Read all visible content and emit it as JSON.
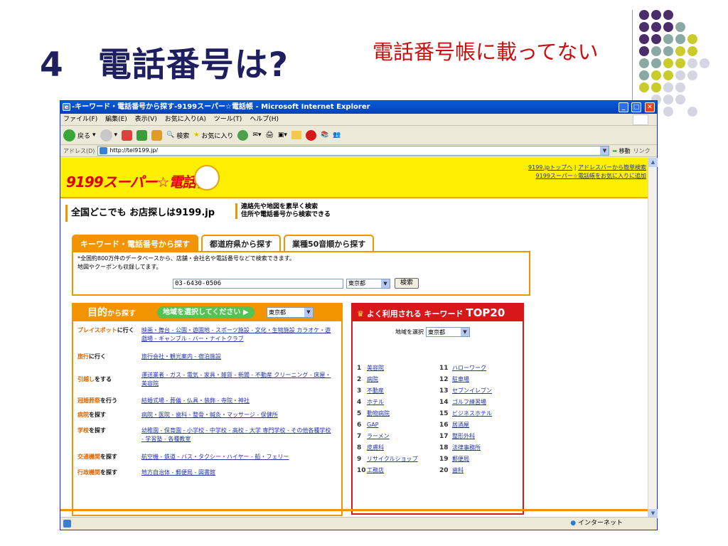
{
  "slide": {
    "title": "4　電話番号は?",
    "subtitle": "電話番号帳に載ってない"
  },
  "window": {
    "title": "-キーワード・電話番号から探す-9199スーパー☆電話帳 - Microsoft Internet Explorer",
    "menu": [
      "ファイル(F)",
      "編集(E)",
      "表示(V)",
      "お気に入り(A)",
      "ツール(T)",
      "ヘルプ(H)"
    ],
    "toolbar": {
      "back": "戻る",
      "search": "検索",
      "favorites": "お気に入り"
    },
    "address_label": "アドレス(D)",
    "address_value": "http://tel9199.jp/",
    "go_label": "移動",
    "links_label": "リンク",
    "status_zone": "インターネット"
  },
  "page": {
    "logo": "9199スーパー☆電話帳",
    "header_links": [
      "9199.jpトップへ",
      "アドレスバーから簡単検索",
      "9199スーパー☆電話帳をお気に入りに追加"
    ],
    "tagline": "全国どこでも お店探しは9199.jp",
    "tagline2": [
      "連絡先や地図を素早く検索",
      "住所や電話番号から検索できる"
    ],
    "tabs": [
      "キーワード・電話番号から探す",
      "都道府県から探す",
      "業種50音順から探す"
    ],
    "search": {
      "desc1": "*全国約800万件のデータベースから、店舗・会社名や電話番号などで検索できます。",
      "desc2": "地図やクーポンも収録してます。",
      "keyword_value": "03-6430-0506",
      "prefecture": "東京都",
      "button": "検索"
    },
    "purpose": {
      "title": "目的",
      "title_suffix": "から探す",
      "region_prompt": "地域を選択してください ▶",
      "region_value": "東京都",
      "rows": [
        {
          "label_em": "プレイスポット",
          "label": "に行く",
          "links": "映画・舞台 - 公園・遊園地 - スポーツ施設 - 文化・生物施設 カラオケ・遊戯場 - ギャンブル - バー・ナイトクラブ"
        },
        {
          "label_em": "旅行",
          "label": "に行く",
          "links": "旅行会社・観光案内 - 宿泊施設"
        },
        {
          "label_em": "引越し",
          "label": "をする",
          "links": "運送業者 - ガス - 電気 - 家具・雑貨 - 新聞 - 不動産 クリーニング - 床屋・美容院"
        },
        {
          "label_em": "冠婚葬祭",
          "label": "を行う",
          "links": "結婚式場 - 葬儀 - 仏具・装飾 - 寺院・神社"
        },
        {
          "label_em": "病院",
          "label": "を探す",
          "links": "病院・医院 - 歯科 - 整骨・鍼灸・マッサージ - 保健所"
        },
        {
          "label_em": "学校",
          "label": "を探す",
          "links": "幼稚園 - 保育園 - 小学校 - 中学校 - 高校 - 大学 専門学校 - その他各種学校 - 学習塾 - 各種教室"
        },
        {
          "label_em": "交通機関",
          "label": "を探す",
          "links": "航空機 - 鉄道 - バス・タクシー・ハイヤー - 船・フェリー"
        },
        {
          "label_em": "行政機関",
          "label": "を探す",
          "links": "地方自治体 - 郵便局 - 図書館"
        }
      ]
    },
    "top20": {
      "head_small": "よく利用される キーワード",
      "head_big": "TOP20",
      "region_label": "地域を選択",
      "region_value": "東京都",
      "items": [
        "美容院",
        "病院",
        "不動産",
        "ホテル",
        "動物病院",
        "GAP",
        "ラーメン",
        "皮膚科",
        "リサイクルショップ",
        "工務店",
        "ハローワーク",
        "駐車場",
        "セブンイレブン",
        "ゴルフ練習場",
        "ビジネスホテル",
        "居酒屋",
        "整形外科",
        "法律事務所",
        "郵便局",
        "歯科"
      ]
    }
  }
}
